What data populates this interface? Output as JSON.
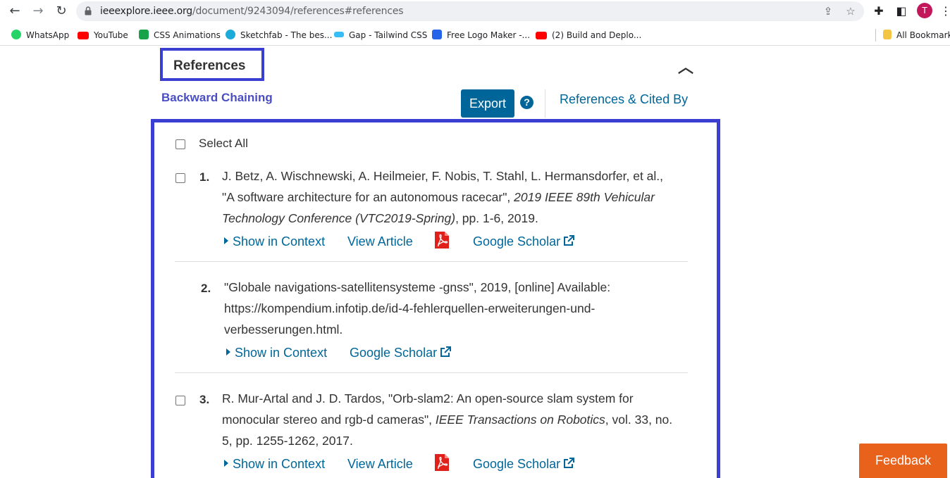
{
  "browser": {
    "url_host": "ieeexplore.ieee.org",
    "url_path": "/document/9243094/references#references",
    "profile_initial": "T",
    "bookmarks": [
      {
        "label": "WhatsApp",
        "color": "#25d366"
      },
      {
        "label": "YouTube",
        "color": "#ff0000"
      },
      {
        "label": "CSS Animations",
        "color": "#16a34a"
      },
      {
        "label": "Sketchfab - The bes...",
        "color": "#1caad9"
      },
      {
        "label": "Gap - Tailwind CSS",
        "color": "#38bdf8"
      },
      {
        "label": "Free Logo Maker -...",
        "color": "#2563eb"
      },
      {
        "label": "(2) Build and Deplo...",
        "color": "#ff0000"
      }
    ],
    "all_bookmarks": "All Bookmarks"
  },
  "section": {
    "heading": "References",
    "backward_chaining": "Backward Chaining",
    "export_label": "Export",
    "help_glyph": "?",
    "refs_cited_by": "References & Cited By",
    "select_all": "Select All"
  },
  "references": [
    {
      "num": "1.",
      "text_before": "J. Betz, A. Wischnewski, A. Heilmeier, F. Nobis, T. Stahl, L. Hermansdorfer, et al., \"A software architecture for an autonomous racecar\", ",
      "venue": "2019 IEEE 89th Vehicular Technology Conference (VTC2019-Spring)",
      "text_after": ", pp. 1-6, 2019.",
      "show_context": "Show in Context",
      "view_article": "View Article",
      "scholar": "Google Scholar"
    },
    {
      "num": "2.",
      "text_before": "\"Globale navigations-satellitensysteme -gnss\", 2019, [online] Available: https://kompendium.infotip.de/id-4-fehlerquellen-erweiterungen-und-verbesserungen.html.",
      "show_context": "Show in Context",
      "scholar": "Google Scholar"
    },
    {
      "num": "3.",
      "text_before": "R. Mur-Artal and J. D. Tardos, \"Orb-slam2: An open-source slam system for monocular stereo and rgb-d cameras\", ",
      "venue": "IEEE Transactions on Robotics",
      "text_after": ", vol. 33, no. 5, pp. 1255-1262, 2017.",
      "show_context": "Show in Context",
      "view_article": "View Article",
      "scholar": "Google Scholar"
    }
  ],
  "feedback": "Feedback"
}
